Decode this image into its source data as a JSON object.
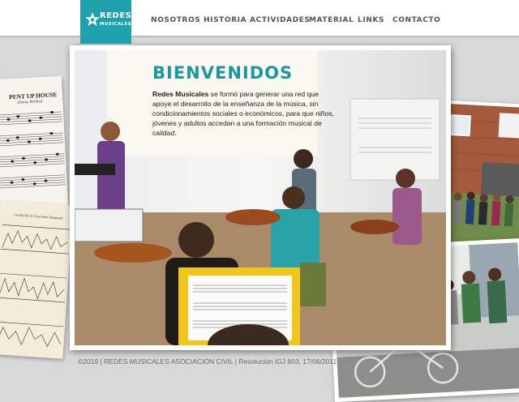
{
  "logo": {
    "line1": "REDES",
    "line2": "MUSICALES"
  },
  "nav": {
    "items": [
      {
        "label": "NOSOTROS"
      },
      {
        "label": "HISTORIA"
      },
      {
        "label": "ACTIVIDADES"
      },
      {
        "label": "MATERIAL"
      },
      {
        "label": "LINKS"
      },
      {
        "label": "CONTACTO"
      }
    ]
  },
  "welcome": {
    "title": "BIENVENIDOS",
    "brand": "Redes Musicales",
    "body": " se formó para generar una red que apoye el desarrollo de la enseñanza de la música, sin condicionamientos sociales o económicos, para que niños, jóvenes y adultos accedan a una formación musical de calidad."
  },
  "sheets": {
    "left_title": "PENT UP HOUSE",
    "left_subtitle": "(Sonny Rollins)",
    "left_bottom_caption": "J.S.BACH: El Clave Bien Temperado"
  },
  "footer": {
    "text": "©2019 | REDES MUSICALES ASOCIACIÓN CIVIL | Resolución IGJ 803, 17/06/2011"
  },
  "colors": {
    "accent": "#1ea1ad",
    "title": "#1a97a5",
    "nav_text": "#555555"
  }
}
